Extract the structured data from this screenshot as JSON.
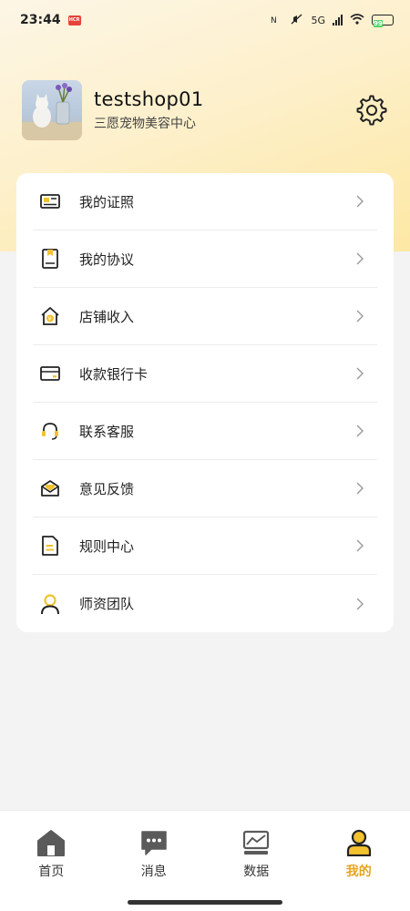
{
  "status_bar": {
    "time": "23:44",
    "notif_badge": "HCR",
    "signal_text": "5G",
    "battery": "99"
  },
  "profile": {
    "shop_name": "testshop01",
    "subtitle": "三愿宠物美容中心"
  },
  "menu": {
    "items": [
      {
        "label": "我的证照",
        "icon": "license-icon"
      },
      {
        "label": "我的协议",
        "icon": "agreement-icon"
      },
      {
        "label": "店铺收入",
        "icon": "store-income-icon"
      },
      {
        "label": "收款银行卡",
        "icon": "bank-card-icon"
      },
      {
        "label": "联系客服",
        "icon": "headset-icon"
      },
      {
        "label": "意见反馈",
        "icon": "feedback-envelope-icon"
      },
      {
        "label": "规则中心",
        "icon": "rules-document-icon"
      },
      {
        "label": "师资团队",
        "icon": "team-person-icon"
      }
    ]
  },
  "bottom_nav": {
    "items": [
      {
        "label": "首页",
        "icon": "home-icon",
        "active": false
      },
      {
        "label": "消息",
        "icon": "message-icon",
        "active": false
      },
      {
        "label": "数据",
        "icon": "data-chart-icon",
        "active": false
      },
      {
        "label": "我的",
        "icon": "profile-icon",
        "active": true
      }
    ]
  },
  "colors": {
    "accent": "#e6a51c",
    "icon_yellow": "#f2c230",
    "header_gradient_end": "#fde8a4"
  }
}
